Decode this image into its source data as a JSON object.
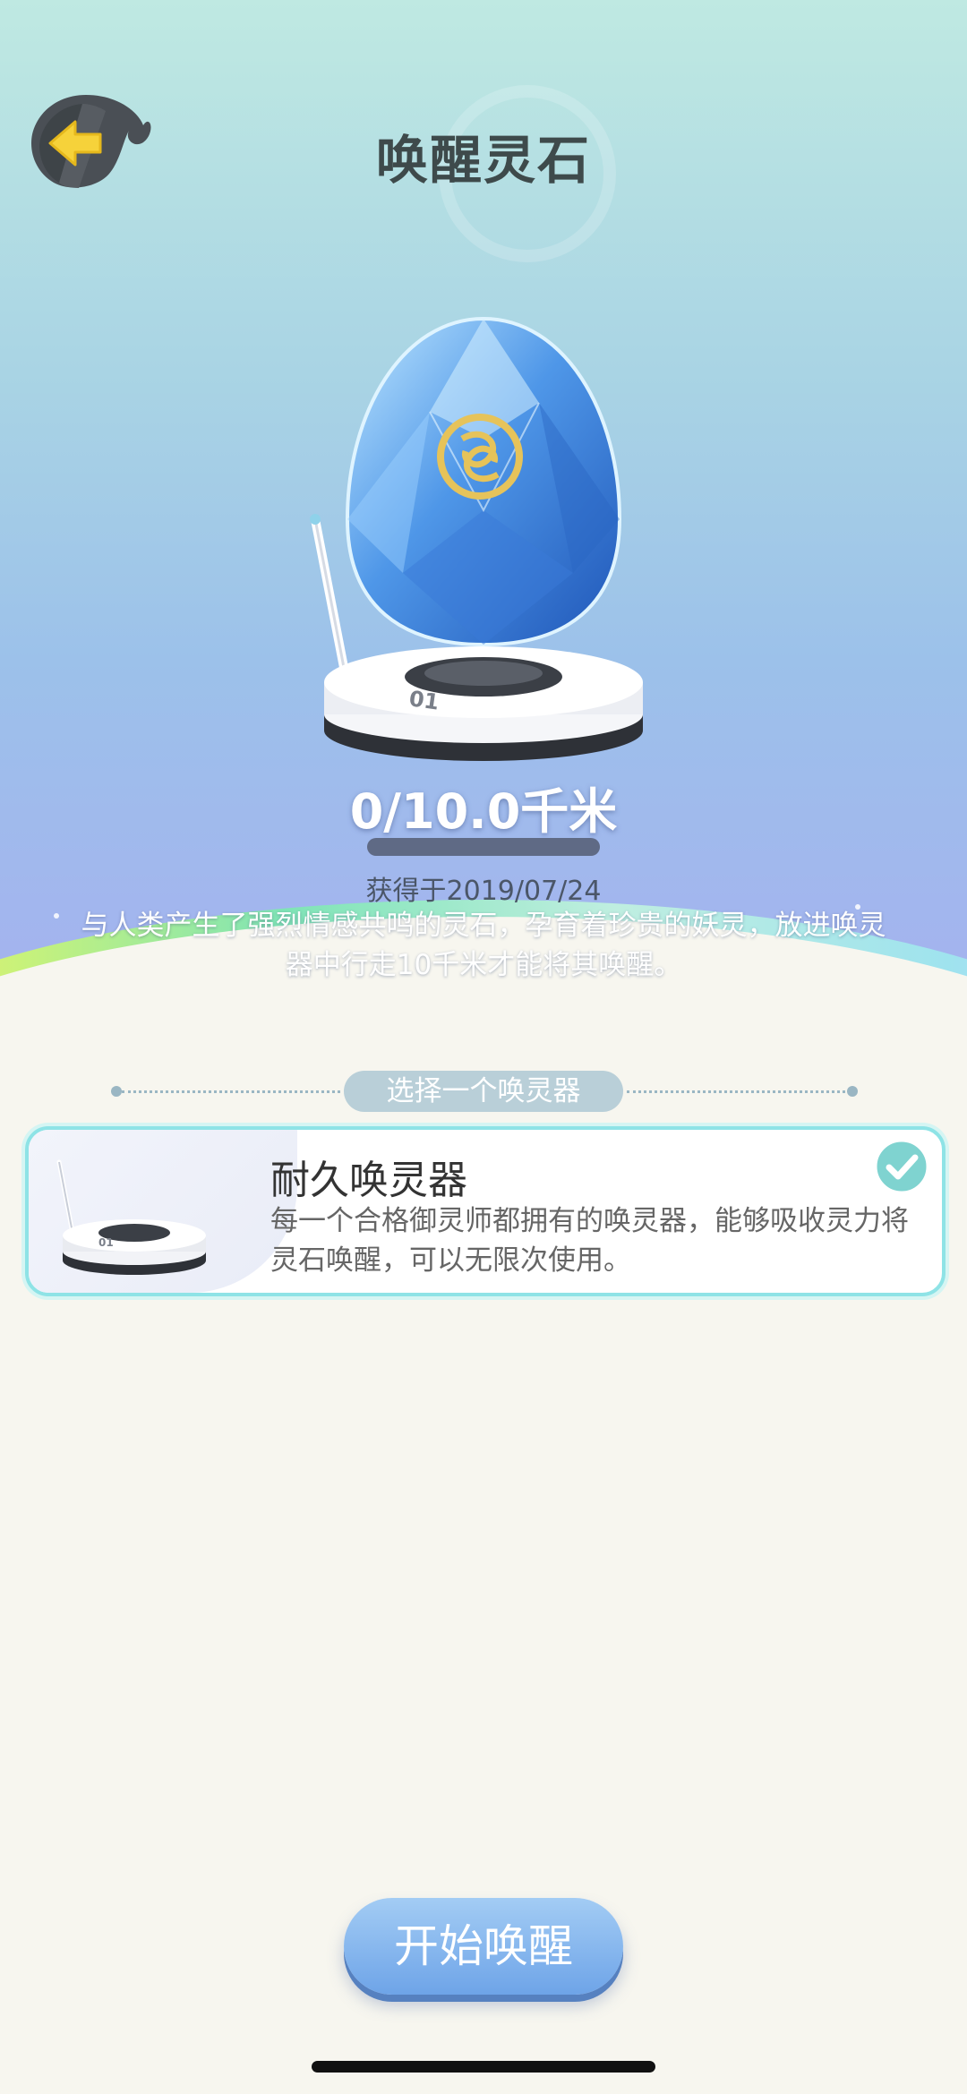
{
  "header": {
    "title": "唤醒灵石",
    "back_icon": "arrow-left-icon"
  },
  "stone": {
    "distance_text": "0/10.0千米",
    "progress_fraction": 0,
    "obtained_text": "获得于2019/07/24",
    "description": "与人类产生了强烈情感共鸣的灵石，孕育着珍贵的妖灵，放进唤灵器中行走10千米才能将其唤醒。"
  },
  "section": {
    "label": "选择一个唤灵器"
  },
  "device": {
    "title": "耐久唤灵器",
    "description": "每一个合格御灵师都拥有的唤灵器，能够吸收灵力将灵石唤醒，可以无限次使用。",
    "selected": true,
    "check_icon": "check-circle-icon"
  },
  "actions": {
    "start_label": "开始唤醒"
  },
  "colors": {
    "accent": "#6ea4e8",
    "card_border": "#8ee3e6",
    "check": "#7fd3d0"
  }
}
